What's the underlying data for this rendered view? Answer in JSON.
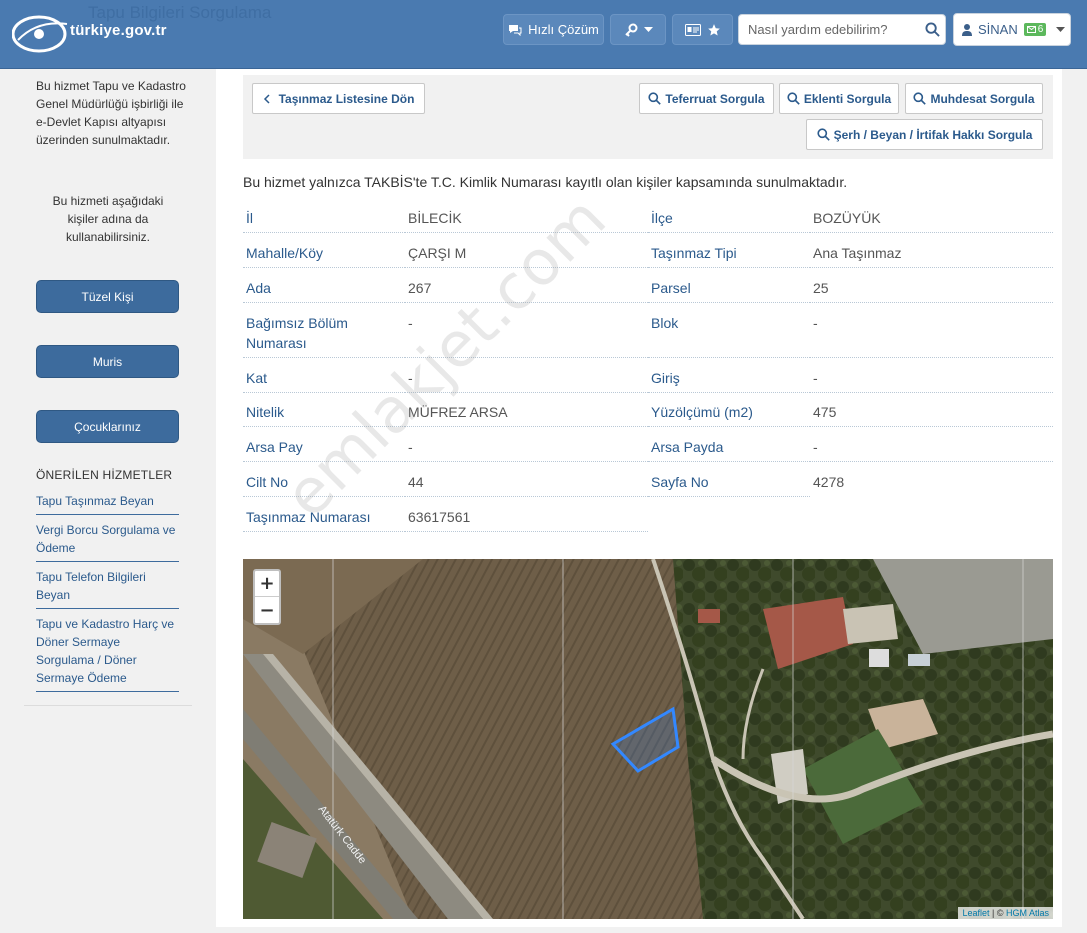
{
  "header": {
    "page_title": "Tapu Bilgileri Sorgulama",
    "logo_text": "türkiye.gov.tr",
    "hizli_cozum": "Hızlı Çözüm",
    "search_placeholder": "Nasıl yardım edebilirim?",
    "user_name": "SİNAN",
    "message_count": "6",
    "colors": {
      "header_bg": "#4a7ab0",
      "badge_bg": "#5cb85c"
    }
  },
  "sidebar": {
    "intro": "Bu hizmet Tapu ve Kadastro Genel Müdürlüğü işbirliği ile e-Devlet Kapısı altyapısı üzerinden sunulmaktadır.",
    "on_behalf": "Bu hizmeti aşağıdaki kişiler adına da kullanabilirsiniz.",
    "buttons": [
      "Tüzel Kişi",
      "Muris",
      "Çocuklarınız"
    ],
    "recommended_heading": "ÖNERİLEN HİZMETLER",
    "recommended": [
      "Tapu Taşınmaz Beyan",
      "Vergi Borcu Sorgulama ve Ödeme",
      "Tapu Telefon Bilgileri Beyan",
      "Tapu ve Kadastro Harç ve Döner Sermaye Sorgulama / Döner Sermaye Ödeme"
    ]
  },
  "toolbar": {
    "back": "Taşınmaz Listesine Dön",
    "teferruat": "Teferruat Sorgula",
    "eklenti": "Eklenti Sorgula",
    "muhdesat": "Muhdesat Sorgula",
    "serh": "Şerh / Beyan / İrtifak Hakkı Sorgula"
  },
  "notice": "Bu hizmet yalnızca TAKBİS'te T.C. Kimlik Numarası kayıtlı olan kişiler kapsamında sunulmaktadır.",
  "details": {
    "il_label": "İl",
    "il": "BİLECİK",
    "ilce_label": "İlçe",
    "ilce": "BOZÜYÜK",
    "mahalle_label": "Mahalle/Köy",
    "mahalle": "ÇARŞI M",
    "tip_label": "Taşınmaz Tipi",
    "tip": "Ana Taşınmaz",
    "ada_label": "Ada",
    "ada": "267",
    "parsel_label": "Parsel",
    "parsel": "25",
    "bagimsiz_label_1": "Bağımsız Bölüm",
    "bagimsiz_label_2": "Numarası",
    "bagimsiz": "-",
    "blok_label": "Blok",
    "blok": "-",
    "kat_label": "Kat",
    "kat": "-",
    "giris_label": "Giriş",
    "giris": "-",
    "nitelik_label": "Nitelik",
    "nitelik": "MÜFREZ ARSA",
    "yuzolcum_label": "Yüzölçümü (m2)",
    "yuzolcum": "475",
    "arsa_pay_label": "Arsa Pay",
    "arsa_pay": "-",
    "arsa_payda_label": "Arsa Payda",
    "arsa_payda": "-",
    "cilt_label": "Cilt No",
    "cilt": "44",
    "sayfa_label": "Sayfa No",
    "sayfa": "4278",
    "numara_label": "Taşınmaz Numarası",
    "numara": "63617561"
  },
  "map": {
    "zoom_in": "+",
    "zoom_out": "−",
    "road_label": "Atatürk Cadde",
    "attrib_leaflet": "Leaflet",
    "attrib_sep": " | © ",
    "attrib_hgm": "HGM Atlas"
  },
  "watermark": "emlakjet.com"
}
